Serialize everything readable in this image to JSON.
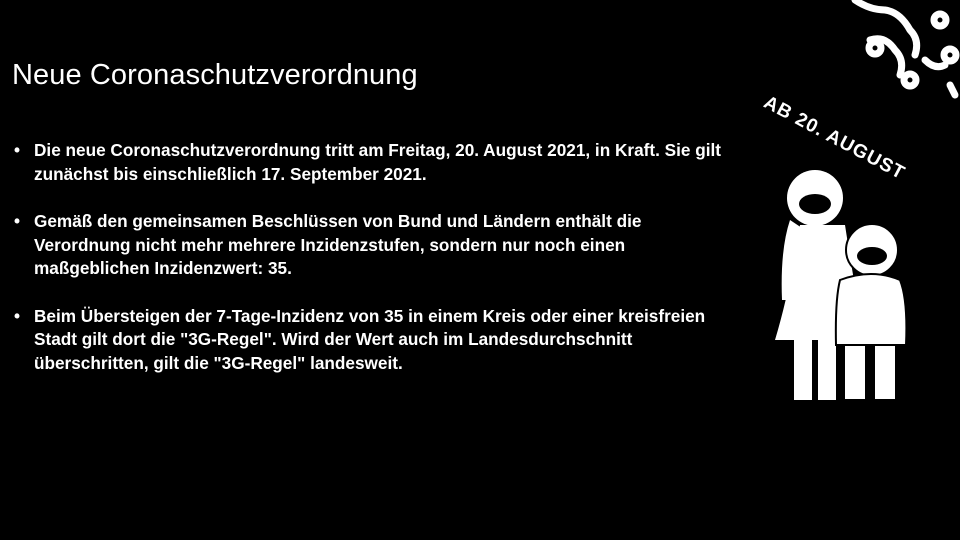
{
  "title": "Neue Coronaschutzverordnung",
  "bullets": [
    "Die neue Coronaschutzverordnung tritt am Freitag, 20. August 2021, in Kraft. Sie gilt zunächst bis einschließlich 17. September 2021.",
    "Gemäß den gemeinsamen Beschlüssen von Bund und Ländern enthält die Verordnung nicht mehr mehrere Inzidenzstufen, sondern nur noch einen maßgeblichen Inzidenzwert: 35.",
    "Beim Übersteigen der 7-Tage-Inzidenz von 35 in einem Kreis oder einer kreisfreien Stadt gilt dort die \"3G-Regel\". Wird der Wert auch im Landesdurchschnitt überschritten, gilt die \"3G-Regel\" landesweit."
  ],
  "badge": "AB 20. AUGUST"
}
